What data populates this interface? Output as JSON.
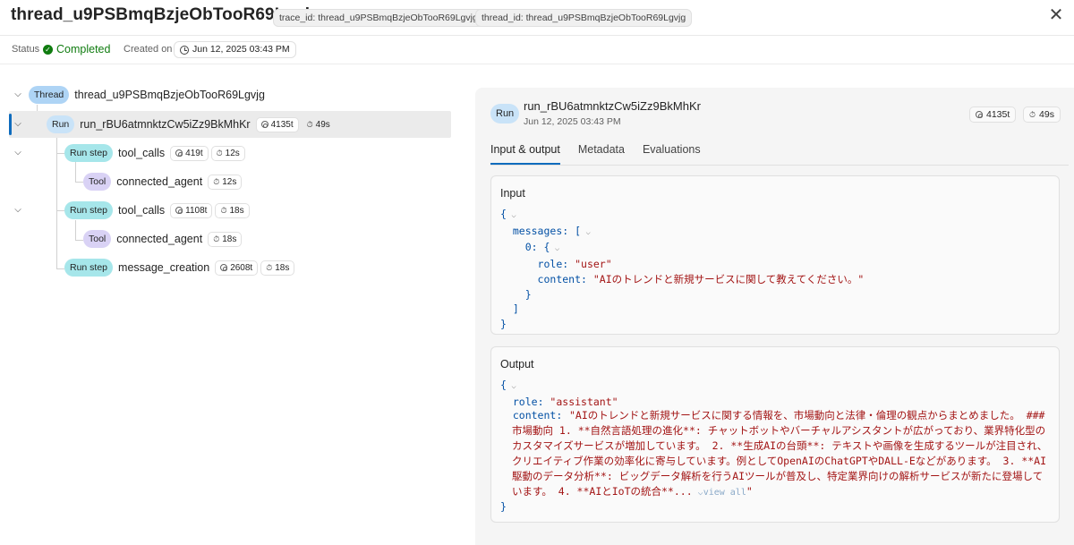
{
  "header": {
    "title": "thread_u9PSBmqBzjeObTooR69Lgvjg",
    "trace_chip": "trace_id: thread_u9PSBmqBzjeObTooR69Lgvjg",
    "thread_chip": "thread_id: thread_u9PSBmqBzjeObTooR69Lgvjg",
    "close_glyph": "✕"
  },
  "status_row": {
    "status_label": "Status",
    "status_value": "Completed",
    "created_label": "Created on",
    "created_value": "Jun 12, 2025 03:43 PM"
  },
  "tree": {
    "thread": {
      "type": "Thread",
      "name": "thread_u9PSBmqBzjeObTooR69Lgvjg"
    },
    "run": {
      "type": "Run",
      "name": "run_rBU6atmnktzCw5iZz9BkMhKr",
      "tokens": "4135t",
      "duration": "49s"
    },
    "steps": [
      {
        "type": "Run step",
        "name": "tool_calls",
        "tokens": "419t",
        "duration": "12s",
        "tool": {
          "type": "Tool",
          "name": "connected_agent",
          "duration": "12s"
        }
      },
      {
        "type": "Run step",
        "name": "tool_calls",
        "tokens": "1108t",
        "duration": "18s",
        "tool": {
          "type": "Tool",
          "name": "connected_agent",
          "duration": "18s"
        }
      },
      {
        "type": "Run step",
        "name": "message_creation",
        "tokens": "2608t",
        "duration": "18s"
      }
    ]
  },
  "detail": {
    "badge": "Run",
    "name": "run_rBU6atmnktzCw5iZz9BkMhKr",
    "date": "Jun 12, 2025 03:43 PM",
    "tokens": "4135t",
    "duration": "49s",
    "tabs": [
      "Input & output",
      "Metadata",
      "Evaluations"
    ],
    "active_tab": "Input & output",
    "input": {
      "title": "Input",
      "messages_key": "messages",
      "index_key": "0",
      "role_key": "role",
      "role_value": "\"user\"",
      "content_key": "content",
      "content_value": "\"AIのトレンドと新規サービスに関して教えてください。\""
    },
    "output": {
      "title": "Output",
      "role_key": "role",
      "role_value": "\"assistant\"",
      "content_key": "content",
      "content_value": "\"AIのトレンドと新規サービスに関する情報を、市場動向と法律・倫理の観点からまとめました。 ### 市場動向 1. **自然言語処理の進化**: チャットボットやバーチャルアシスタントが広がっており、業界特化型のカスタマイズサービスが増加しています。 2. **生成AIの台頭**: テキストや画像を生成するツールが注目され、クリエイティブ作業の効率化に寄与しています。例としてOpenAIのChatGPTやDALL-Eなどがあります。 3. **AI駆動のデータ分析**: ビッグデータ解析を行うAIツールが普及し、特定業界向けの解析サービスが新たに登場しています。 4. **AIとIoTの統合**...",
      "view_all": "view all",
      "closing_quote": "\""
    }
  },
  "colors": {
    "accent": "#0f6cbd",
    "success": "#107c10",
    "thread_pill": "#aed4f5",
    "run_pill": "#c9e3f8",
    "step_pill": "#a6e6ea",
    "tool_pill": "#d9d2f5",
    "json_key": "#0451a5",
    "json_string": "#a31515"
  }
}
